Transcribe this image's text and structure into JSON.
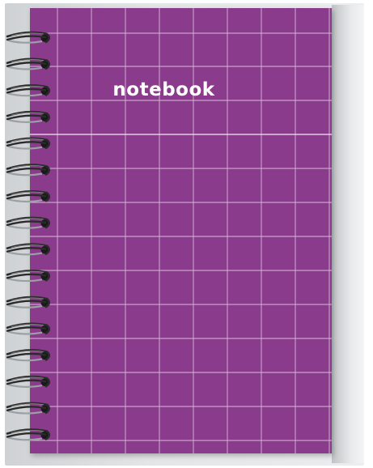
{
  "cover": {
    "title": "notebook",
    "color": "#8a3b8b",
    "grid_color": "#d8b8d8",
    "pattern": "square-grid"
  },
  "binding": {
    "type": "spiral",
    "ring_count": 16,
    "ring_color": "#2b2b2b"
  },
  "pages": {
    "color": "#e3e5e6"
  }
}
